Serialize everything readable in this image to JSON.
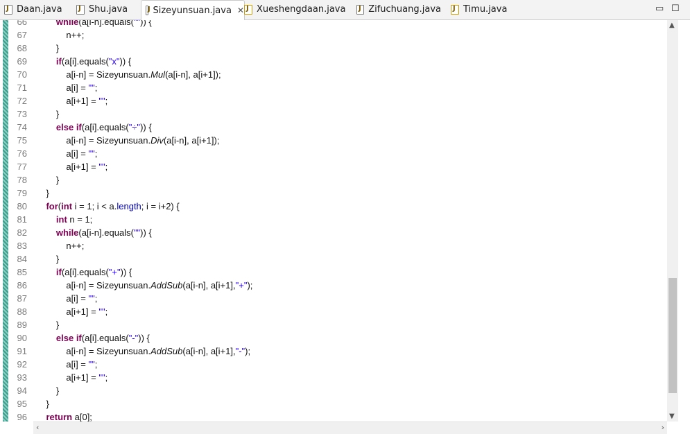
{
  "tabs": [
    {
      "label": "Daan.java",
      "active": false
    },
    {
      "label": "Shu.java",
      "active": false
    },
    {
      "label": "Sizeyunsuan.java",
      "active": true
    },
    {
      "label": "Xueshengdaan.java",
      "active": false
    },
    {
      "label": "Zifuchuang.java",
      "active": false
    },
    {
      "label": "Timu.java",
      "active": false
    }
  ],
  "window": {
    "minimize": "🗕",
    "maximize": "🗖"
  },
  "lines": [
    {
      "n": "66",
      "html": "        <span class='kw'>while</span>(a[i-n].equals(<span class='str'>\"\"</span>)) {"
    },
    {
      "n": "67",
      "html": "            n++;"
    },
    {
      "n": "68",
      "html": "        }"
    },
    {
      "n": "69",
      "html": "        <span class='kw'>if</span>(a[i].equals(<span class='str'>\"x\"</span>)) {"
    },
    {
      "n": "70",
      "html": "            a[i-n] = Sizeyunsuan.<span class='mtd'>Mul</span>(a[i-n], a[i+1]);"
    },
    {
      "n": "71",
      "html": "            a[i] = <span class='str'>\"\"</span>;"
    },
    {
      "n": "72",
      "html": "            a[i+1] = <span class='str'>\"\"</span>;"
    },
    {
      "n": "73",
      "html": "        }"
    },
    {
      "n": "74",
      "html": "        <span class='kw'>else if</span>(a[i].equals(<span class='str'>\"÷\"</span>)) {"
    },
    {
      "n": "75",
      "html": "            a[i-n] = Sizeyunsuan.<span class='mtd'>Div</span>(a[i-n], a[i+1]);"
    },
    {
      "n": "76",
      "html": "            a[i] = <span class='str'>\"\"</span>;"
    },
    {
      "n": "77",
      "html": "            a[i+1] = <span class='str'>\"\"</span>;"
    },
    {
      "n": "78",
      "html": "        }"
    },
    {
      "n": "79",
      "html": "    }"
    },
    {
      "n": "80",
      "html": "    <span class='kw'>for</span>(<span class='kw'>int</span> i = 1; i &lt; a.<span class='fld'>length</span>; i = i+2) {"
    },
    {
      "n": "81",
      "html": "        <span class='kw'>int</span> n = 1;"
    },
    {
      "n": "82",
      "html": "        <span class='kw'>while</span>(a[i-n].equals(<span class='str'>\"\"</span>)) {"
    },
    {
      "n": "83",
      "html": "            n++;"
    },
    {
      "n": "84",
      "html": "        }"
    },
    {
      "n": "85",
      "html": "        <span class='kw'>if</span>(a[i].equals(<span class='str'>\"+\"</span>)) {"
    },
    {
      "n": "86",
      "html": "            a[i-n] = Sizeyunsuan.<span class='mtd'>AddSub</span>(a[i-n], a[i+1],<span class='str'>\"+\"</span>);"
    },
    {
      "n": "87",
      "html": "            a[i] = <span class='str'>\"\"</span>;"
    },
    {
      "n": "88",
      "html": "            a[i+1] = <span class='str'>\"\"</span>;"
    },
    {
      "n": "89",
      "html": "        }"
    },
    {
      "n": "90",
      "html": "        <span class='kw'>else if</span>(a[i].equals(<span class='str'>\"-\"</span>)) {"
    },
    {
      "n": "91",
      "html": "            a[i-n] = Sizeyunsuan.<span class='mtd'>AddSub</span>(a[i-n], a[i+1],<span class='str'>\"-\"</span>);"
    },
    {
      "n": "92",
      "html": "            a[i] = <span class='str'>\"\"</span>;"
    },
    {
      "n": "93",
      "html": "            a[i+1] = <span class='str'>\"\"</span>;"
    },
    {
      "n": "94",
      "html": "        }"
    },
    {
      "n": "95",
      "html": "    }"
    },
    {
      "n": "96",
      "html": "    <span class='kw'>return</span> a[0];"
    }
  ],
  "scroll": {
    "vertical_position_fraction": 0.72
  }
}
